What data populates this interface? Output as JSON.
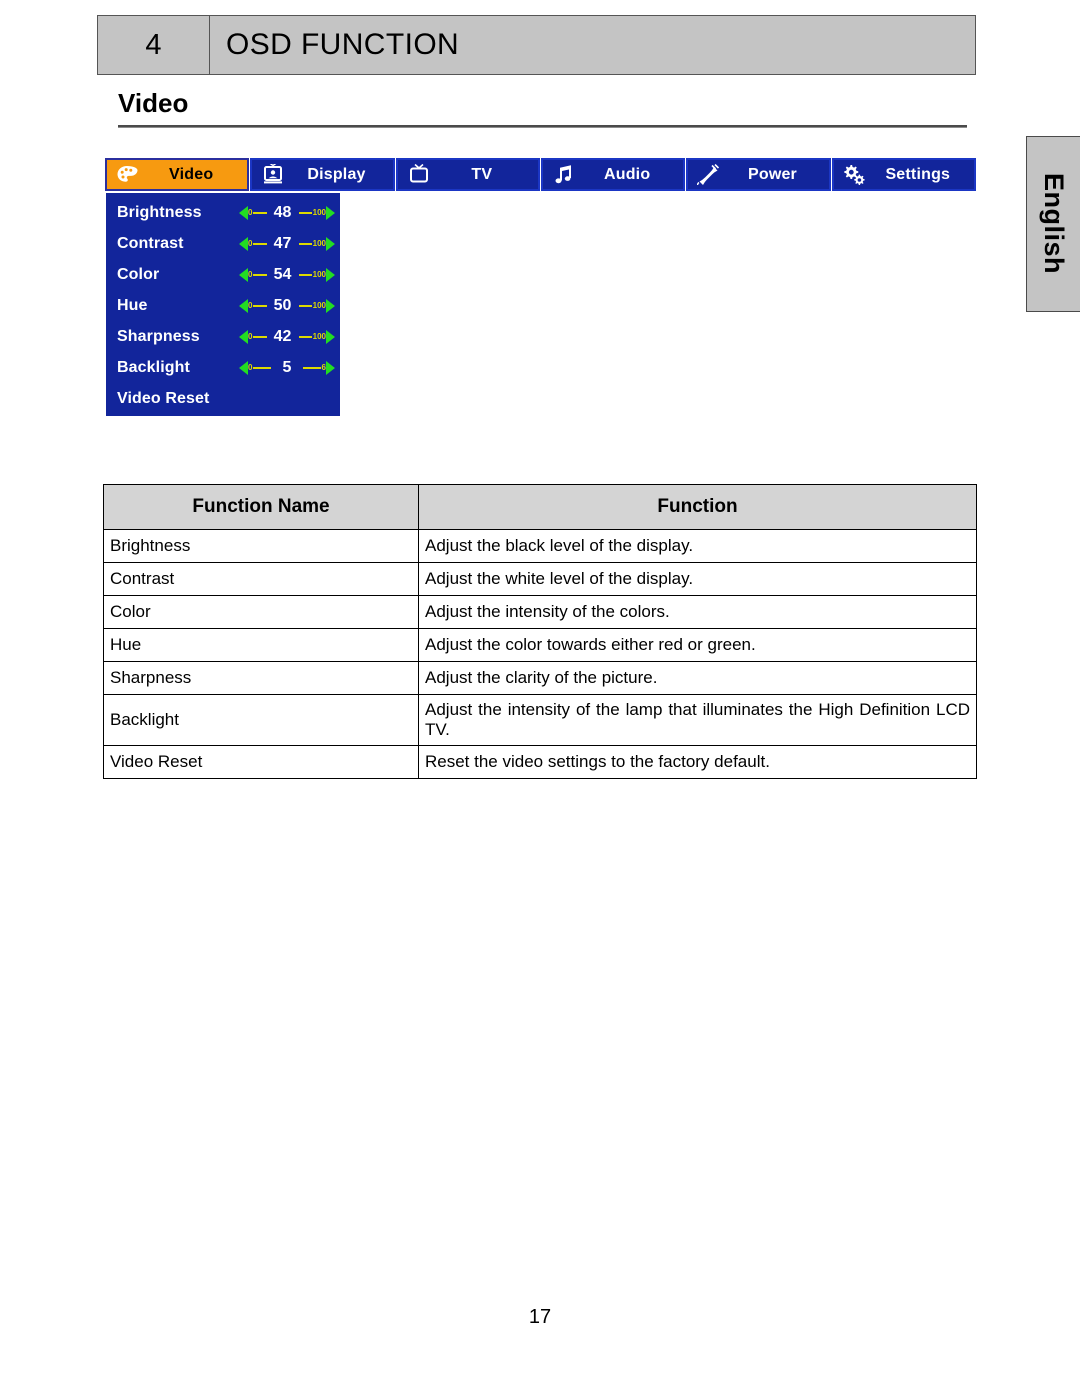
{
  "header": {
    "chapter_number": "4",
    "chapter_title": "OSD FUNCTION"
  },
  "section": {
    "title": "Video"
  },
  "language_tab": {
    "label": "English"
  },
  "osd": {
    "tabs": [
      {
        "label": "Video",
        "icon": "palette-icon",
        "active": true
      },
      {
        "label": "Display",
        "icon": "monitor-icon",
        "active": false
      },
      {
        "label": "TV",
        "icon": "tv-icon",
        "active": false
      },
      {
        "label": "Audio",
        "icon": "music-note-icon",
        "active": false
      },
      {
        "label": "Power",
        "icon": "power-plug-icon",
        "active": false
      },
      {
        "label": "Settings",
        "icon": "gears-icon",
        "active": false
      }
    ],
    "menu_items": [
      {
        "label": "Brightness",
        "min": "0",
        "value": "48",
        "max": "100"
      },
      {
        "label": "Contrast",
        "min": "0",
        "value": "47",
        "max": "100"
      },
      {
        "label": "Color",
        "min": "0",
        "value": "54",
        "max": "100"
      },
      {
        "label": "Hue",
        "min": "0",
        "value": "50",
        "max": "100"
      },
      {
        "label": "Sharpness",
        "min": "0",
        "value": "42",
        "max": "100"
      },
      {
        "label": "Backlight",
        "min": "0",
        "value": "5",
        "max": "6"
      },
      {
        "label": "Video Reset",
        "min": "",
        "value": "",
        "max": ""
      }
    ],
    "colors": {
      "panel_blue": "#12259b",
      "active_tab_orange": "#f79a10",
      "slider_arrow_green": "#22dd22",
      "slider_line_yellow": "#ddd900"
    }
  },
  "table": {
    "headers": [
      "Function Name",
      "Function"
    ],
    "rows": [
      {
        "name": "Brightness",
        "desc": "Adjust the black level of the display."
      },
      {
        "name": "Contrast",
        "desc": "Adjust the white level of the display."
      },
      {
        "name": "Color",
        "desc": "Adjust the intensity of the colors."
      },
      {
        "name": "Hue",
        "desc": "Adjust the color towards either red or green."
      },
      {
        "name": "Sharpness",
        "desc": "Adjust the clarity of the picture."
      },
      {
        "name": "Backlight",
        "desc": "Adjust the intensity of the lamp that illuminates the High Definition LCD TV."
      },
      {
        "name": "Video Reset",
        "desc": "Reset the video settings to the factory default."
      }
    ]
  },
  "footer": {
    "page_number": "17"
  }
}
